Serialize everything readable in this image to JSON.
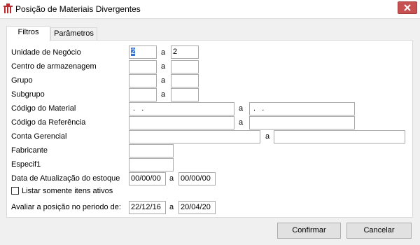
{
  "window": {
    "title": "Posição de Materiais Divergentes"
  },
  "tabs": [
    {
      "label": "Filtros"
    },
    {
      "label": "Parâmetros"
    }
  ],
  "form": {
    "separator": "a",
    "rows": {
      "unidade": {
        "label": "Unidade de Negócio",
        "from": "2",
        "to": "2"
      },
      "centro": {
        "label": "Centro de armazenagem",
        "from": "",
        "to": ""
      },
      "grupo": {
        "label": "Grupo",
        "from": "",
        "to": ""
      },
      "subgrupo": {
        "label": "Subgrupo",
        "from": "",
        "to": ""
      },
      "codigo_material": {
        "label": "Código do Material",
        "from": " .   .",
        "to": " .   ."
      },
      "codigo_referencia": {
        "label": "Código da Referência",
        "from": "",
        "to": ""
      },
      "conta": {
        "label": "Conta Gerencial",
        "from": "",
        "to": ""
      },
      "fabricante": {
        "label": "Fabricante",
        "value": ""
      },
      "especif1": {
        "label": "Especif1",
        "value": ""
      },
      "data_atualizacao": {
        "label": "Data de Atualização do  estoque",
        "from": "00/00/00",
        "to": "00/00/00"
      },
      "listar_ativos": {
        "label": "Listar somente itens ativos",
        "checked": false
      },
      "periodo": {
        "label": "Avaliar a posição no periodo de:",
        "from": "22/12/16",
        "to": "20/04/20"
      }
    }
  },
  "buttons": {
    "confirmar": "Confirmar",
    "cancelar": "Cancelar"
  },
  "icons": {
    "app": "app-logo-icon",
    "close": "close-icon"
  },
  "colors": {
    "close_button": "#c75050",
    "selection": "#3a73d4",
    "app_icon": "#c0282d"
  }
}
